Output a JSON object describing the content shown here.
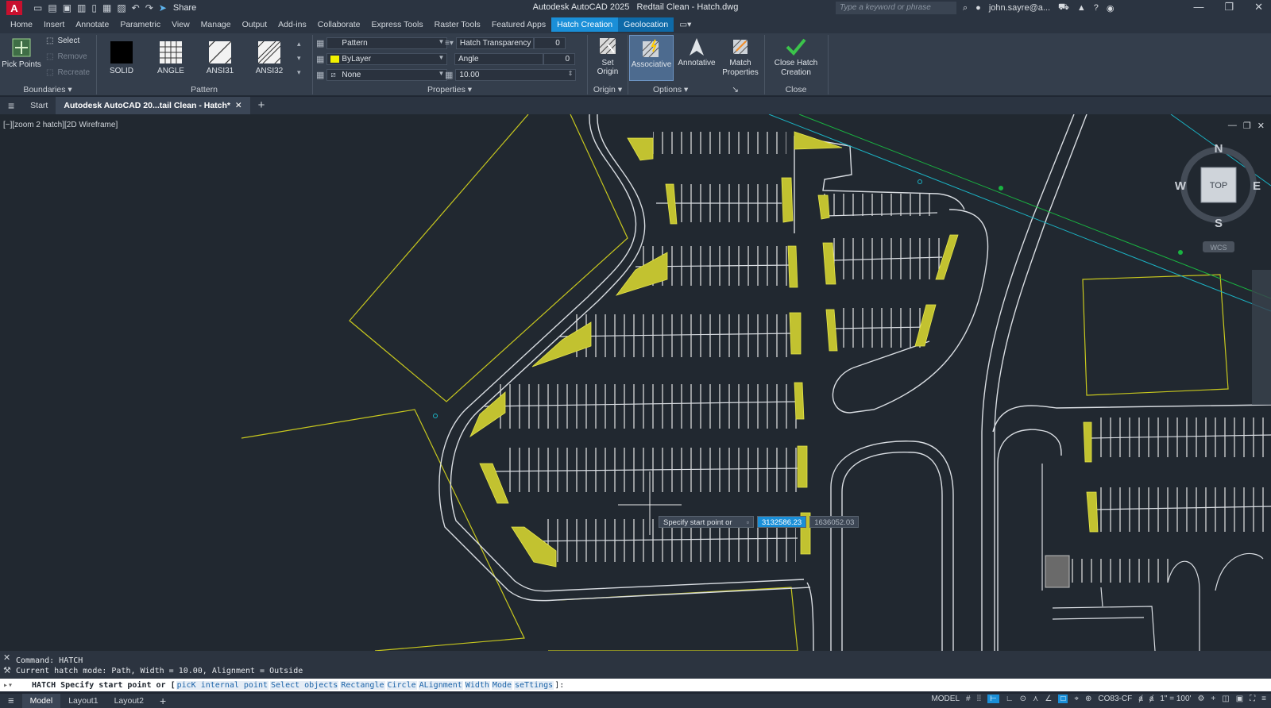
{
  "titlebar": {
    "logo": "A",
    "share": "Share",
    "app_title": "Autodesk AutoCAD 2025",
    "file_title": "Redtail Clean - Hatch.dwg",
    "search_placeholder": "Type a keyword or phrase",
    "user": "john.sayre@a..."
  },
  "menu": {
    "tabs": [
      "Home",
      "Insert",
      "Annotate",
      "Parametric",
      "View",
      "Manage",
      "Output",
      "Add-ins",
      "Collaborate",
      "Express Tools",
      "Raster Tools",
      "Featured Apps",
      "Hatch Creation",
      "Geolocation"
    ],
    "active": "Hatch Creation"
  },
  "ribbon": {
    "boundaries": {
      "pick_points": "Pick Points",
      "select": "Select",
      "remove": "Remove",
      "recreate": "Recreate",
      "title": "Boundaries"
    },
    "pattern": {
      "swatches": [
        "SOLID",
        "ANGLE",
        "ANSI31",
        "ANSI32"
      ],
      "title": "Pattern"
    },
    "properties": {
      "type": "Pattern",
      "color": "ByLayer",
      "background": "None",
      "transparency_label": "Hatch Transparency",
      "transparency_value": "0",
      "angle_label": "Angle",
      "angle_value": "0",
      "scale_value": "10.00",
      "title": "Properties"
    },
    "origin": {
      "set_origin": "Set Origin",
      "title": "Origin"
    },
    "options": {
      "associative": "Associative",
      "annotative": "Annotative",
      "match_properties": "Match Properties",
      "title": "Options"
    },
    "close": {
      "close_hatch": "Close Hatch Creation",
      "title": "Close"
    }
  },
  "filetabs": {
    "start": "Start",
    "active_doc": "Autodesk AutoCAD 20...tail Clean - Hatch*"
  },
  "viewport": {
    "label": "[−][zoom 2 hatch][2D Wireframe]",
    "viewcube": {
      "n": "N",
      "s": "S",
      "e": "E",
      "w": "W",
      "top": "TOP",
      "wcs": "WCS"
    },
    "tooltip": {
      "prompt": "Specify start point or",
      "x": "3132586.23",
      "y": "1636052.03"
    }
  },
  "command": {
    "history": [
      "Command: HATCH",
      "Current hatch mode: Path, Width = 10.00, Alignment = Outside"
    ],
    "prompt_prefix": "HATCH Specify start point or [",
    "options": [
      "picK internal point",
      "Select objects",
      "Rectangle",
      "Circle",
      "ALignment",
      "Width",
      "Mode",
      "seTtings"
    ],
    "prompt_suffix": "]:"
  },
  "status": {
    "tabs": [
      "Model",
      "Layout1",
      "Layout2"
    ],
    "model": "MODEL",
    "coord_system": "CO83-CF",
    "scale": "1\" = 100'"
  },
  "colors": {
    "accent": "#1a8fd8",
    "hatch_yellow": "#c8c81e",
    "linework": "#e8e8e8",
    "canvas": "#212830"
  }
}
